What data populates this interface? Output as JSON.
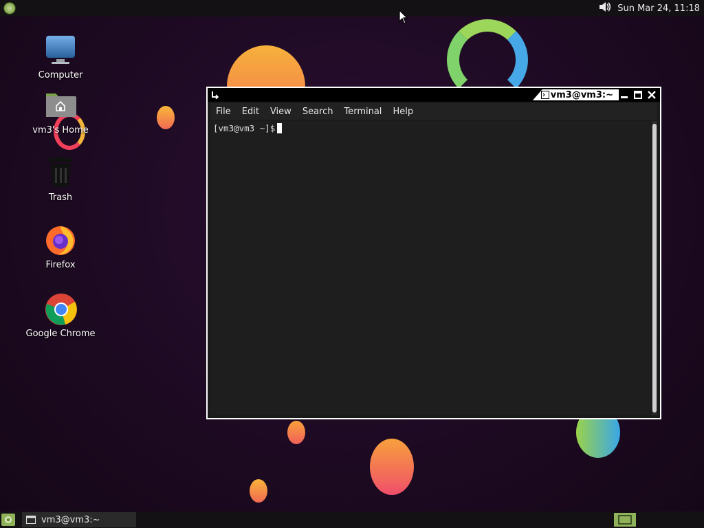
{
  "top_panel": {
    "clock": "Sun Mar 24, 11:18"
  },
  "desktop_icons": [
    {
      "label": "Computer",
      "icon": "computer-icon"
    },
    {
      "label": "vm3's Home",
      "icon": "home-folder-icon"
    },
    {
      "label": "Trash",
      "icon": "trash-icon"
    },
    {
      "label": "Firefox",
      "icon": "firefox-icon"
    },
    {
      "label": "Google Chrome",
      "icon": "chrome-icon"
    }
  ],
  "terminal": {
    "title": "vm3@vm3:~",
    "menu": [
      "File",
      "Edit",
      "View",
      "Search",
      "Terminal",
      "Help"
    ],
    "prompt": "[vm3@vm3 ~]$"
  },
  "taskbar": {
    "items": [
      {
        "label": "vm3@vm3:~"
      }
    ]
  },
  "colors": {
    "accent": "#8fb25a",
    "panel": "#141114",
    "terminal_bg": "#1e1e1e"
  }
}
